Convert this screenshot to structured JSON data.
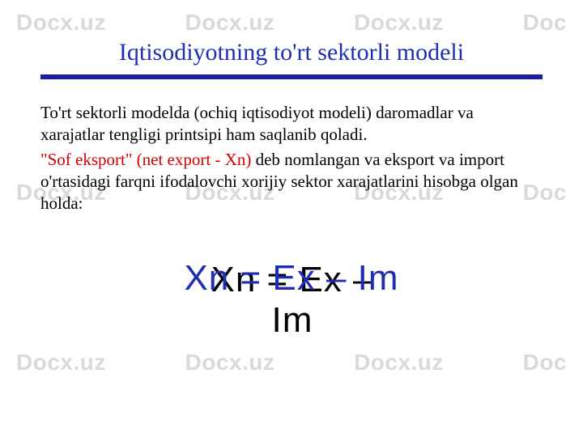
{
  "watermark": {
    "text": "Docx.uz",
    "partial": "Doc"
  },
  "title": "Iqtisodiyotning to'rt sektorli modeli",
  "para1": "To'rt sektorli modelda (ochiq iqtisodiyot modeli) daromadlar va xarajatlar tengligi printsipi ham saqlanib qoladi.",
  "para2_red": "\"Sof eksport\" (net export - Xn)",
  "para2_rest": " deb nomlangan va eksport va import o'rtasidagi farqni ifodalovchi xorijiy sektor xarajatlarini hisobga olgan holda:",
  "formula": "Xn = Ex – Im"
}
